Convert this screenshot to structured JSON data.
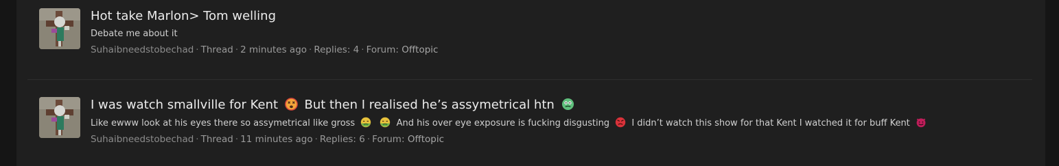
{
  "results": [
    {
      "title": "Hot take Marlon> Tom welling",
      "snippet": "Debate me about it",
      "author": "Suhaibneedstobechad",
      "type": "Thread",
      "time": "2 minutes ago",
      "replies_label": "Replies:",
      "replies": "4",
      "forum_label": "Forum:",
      "forum": "Offtopic"
    },
    {
      "title_parts": [
        "I was watch smallville for Kent",
        "But then I realised he’s assymetrical htn"
      ],
      "snippet_parts": [
        "Like ewww look at his eyes there so assymetrical like gross",
        "And his over eye exposure is fucking disgusting",
        "I didn’t watch this show for that Kent I watched it for buff Kent"
      ],
      "author": "Suhaibneedstobechad",
      "type": "Thread",
      "time": "11 minutes ago",
      "replies_label": "Replies:",
      "replies": "6",
      "forum_label": "Forum:",
      "forum": "Offtopic"
    }
  ],
  "colors": {
    "page_bg": "#151515",
    "panel_bg": "#1f1f1f",
    "title": "#ececec",
    "meta": "#9a9a9a"
  }
}
